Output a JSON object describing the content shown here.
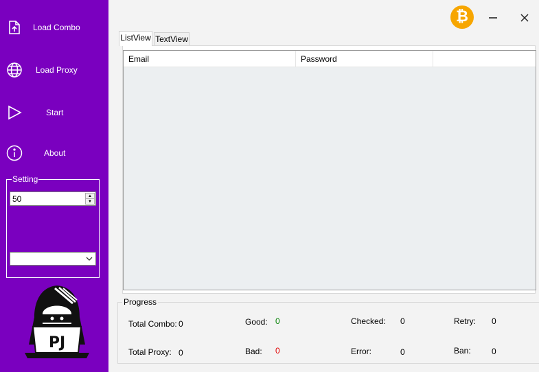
{
  "sidebar": {
    "items": [
      {
        "label": "Load Combo",
        "icon": "file-upload-icon"
      },
      {
        "label": "Load Proxy",
        "icon": "globe-icon"
      },
      {
        "label": "Start",
        "icon": "play-icon"
      },
      {
        "label": "About",
        "icon": "info-icon"
      }
    ],
    "setting": {
      "legend": "Setting",
      "thread_value": "50",
      "dropdown_value": ""
    },
    "logo_text": "PJ"
  },
  "window": {
    "bitcoin_symbol": "₿",
    "accent_color": "#7a00bf",
    "bitcoin_color": "#f7a600"
  },
  "tabs": [
    {
      "label": "ListView",
      "active": true
    },
    {
      "label": "TextView",
      "active": false
    }
  ],
  "listview": {
    "columns": [
      "Email",
      "Password",
      ""
    ],
    "rows": []
  },
  "progress": {
    "legend": "Progress",
    "total_combo": {
      "label": "Total Combo:",
      "value": "0"
    },
    "total_proxy": {
      "label": "Total Proxy:",
      "value": "0"
    },
    "good": {
      "label": "Good:",
      "value": "0",
      "color": "#008000"
    },
    "bad": {
      "label": "Bad:",
      "value": "0",
      "color": "#e00000"
    },
    "checked": {
      "label": "Checked:",
      "value": "0"
    },
    "error": {
      "label": "Error:",
      "value": "0"
    },
    "retry": {
      "label": "Retry:",
      "value": "0"
    },
    "ban": {
      "label": "Ban:",
      "value": "0"
    }
  }
}
